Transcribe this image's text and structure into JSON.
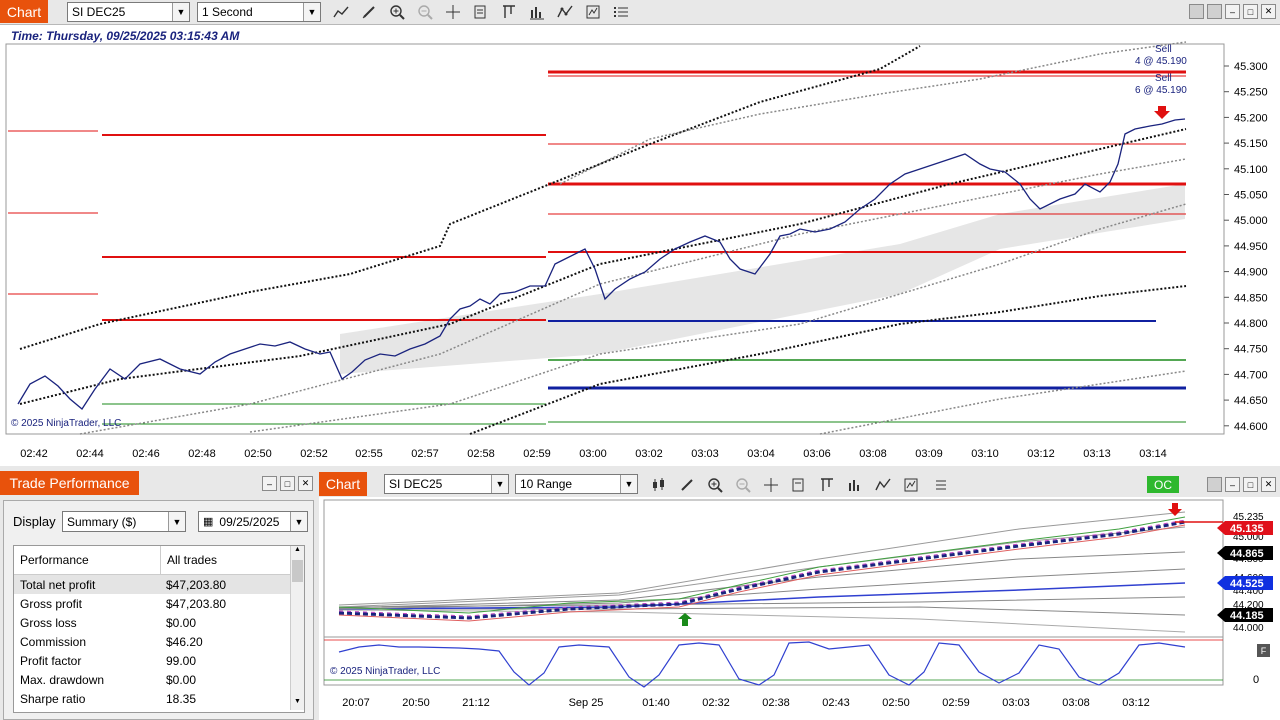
{
  "chart1": {
    "tab_label": "Chart",
    "instrument": "SI DEC25",
    "interval": "1 Second",
    "timestamp": "Time: Thursday, 09/25/2025 03:15:43 AM",
    "copyright": "© 2025 NinjaTrader, LLC",
    "price_ticks": [
      "45.300",
      "45.250",
      "45.200",
      "45.150",
      "45.100",
      "45.050",
      "45.000",
      "44.950",
      "44.900",
      "44.850",
      "44.800",
      "44.750",
      "44.700",
      "44.650",
      "44.600"
    ],
    "time_ticks": [
      "02:42",
      "02:44",
      "02:46",
      "02:48",
      "02:50",
      "02:52",
      "02:55",
      "02:57",
      "02:58",
      "02:59",
      "03:00",
      "03:02",
      "03:03",
      "03:04",
      "03:06",
      "03:08",
      "03:09",
      "03:10",
      "03:12",
      "03:13",
      "03:14"
    ],
    "annotations": [
      {
        "side": "Sell",
        "detail": "4 @ 45.190"
      },
      {
        "side": "Sell",
        "detail": "6 @ 45.190"
      }
    ]
  },
  "trade_performance": {
    "title": "Trade Performance",
    "display_label": "Display",
    "display_value": "Summary ($)",
    "date_value": "09/25/2025",
    "headers": [
      "Performance",
      "All trades"
    ],
    "rows": [
      [
        "Total net profit",
        "$47,203.80"
      ],
      [
        "Gross profit",
        "$47,203.80"
      ],
      [
        "Gross loss",
        "$0.00"
      ],
      [
        "Commission",
        "$46.20"
      ],
      [
        "Profit factor",
        "99.00"
      ],
      [
        "Max. drawdown",
        "$0.00"
      ],
      [
        "Sharpe ratio",
        "18.35"
      ]
    ]
  },
  "chart2": {
    "tab_label": "Chart",
    "instrument": "SI DEC25",
    "interval": "10 Range",
    "oc_label": "OC",
    "copyright": "© 2025 NinjaTrader, LLC",
    "price_ticks": [
      "45.235",
      "45.135",
      "45.000",
      "44.865",
      "44.800",
      "44.600",
      "44.525",
      "44.400",
      "44.185",
      "44.200",
      "44.000"
    ],
    "badges": [
      {
        "value": "45.135",
        "color": "#e0101a"
      },
      {
        "value": "44.865",
        "color": "#000000"
      },
      {
        "value": "44.525",
        "color": "#1030e0"
      },
      {
        "value": "44.185",
        "color": "#000000"
      }
    ],
    "indicator_zero": "0",
    "indicator_btn": "F",
    "time_ticks": [
      "20:07",
      "20:50",
      "21:12",
      "Sep 25",
      "01:40",
      "02:32",
      "02:38",
      "02:43",
      "02:50",
      "02:59",
      "03:03",
      "03:08",
      "03:12"
    ]
  }
}
